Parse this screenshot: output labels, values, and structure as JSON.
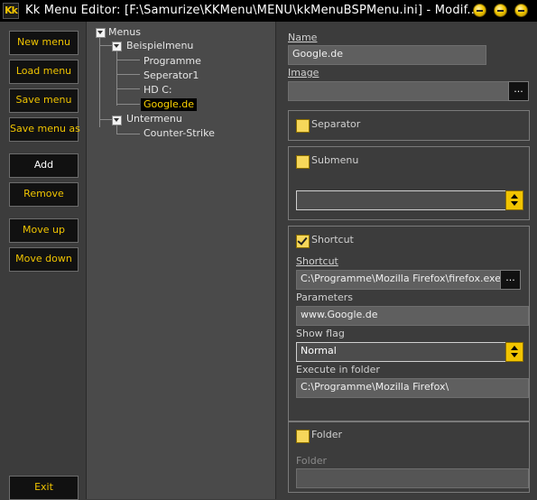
{
  "window": {
    "logo_text": "Kk",
    "title": "Kk Menu Editor: [F:\\Samurize\\KKMenu\\MENU\\kkMenuBSPMenu.ini] - Modif..."
  },
  "sidebar": {
    "new_menu": "New menu",
    "load_menu": "Load menu",
    "save_menu": "Save menu",
    "save_menu_as": "Save menu as",
    "add": "Add",
    "remove": "Remove",
    "move_up": "Move up",
    "move_down": "Move down",
    "exit": "Exit"
  },
  "tree": {
    "root": "Menus",
    "menu1": "Beispielmenu",
    "menu1_items": [
      "Programme",
      "Seperator1",
      "HD C:",
      "Google.de"
    ],
    "menu2": "Untermenu",
    "menu2_items": [
      "Counter-Strike"
    ],
    "selected": "Google.de"
  },
  "properties": {
    "name_label": "Name",
    "name_value": "Google.de",
    "image_label": "Image",
    "image_value": "",
    "browse_label": "...",
    "separator_label": "Separator",
    "separator_checked": false,
    "submenu_label": "Submenu",
    "submenu_checked": false,
    "submenu_value": "",
    "shortcut_check_label": "Shortcut",
    "shortcut_checked": true,
    "shortcut_label": "Shortcut",
    "shortcut_value": "C:\\Programme\\Mozilla Firefox\\firefox.exe",
    "parameters_label": "Parameters",
    "parameters_value": "www.Google.de",
    "showflag_label": "Show flag",
    "showflag_value": "Normal",
    "exec_folder_label": "Execute in folder",
    "exec_folder_value": "C:\\Programme\\Mozilla Firefox\\",
    "folder_check_label": "Folder",
    "folder_checked": false,
    "folder_label": "Folder",
    "folder_value": ""
  },
  "colors": {
    "accent": "#f2c400",
    "background": "#3c3c3c",
    "tree_background": "#4a4a4a",
    "titlebar": "#000000"
  },
  "icons": {
    "window_buttons": [
      "minimize-icon",
      "maximize-icon",
      "close-icon"
    ],
    "tree_expander": "tree-expand-icon"
  }
}
